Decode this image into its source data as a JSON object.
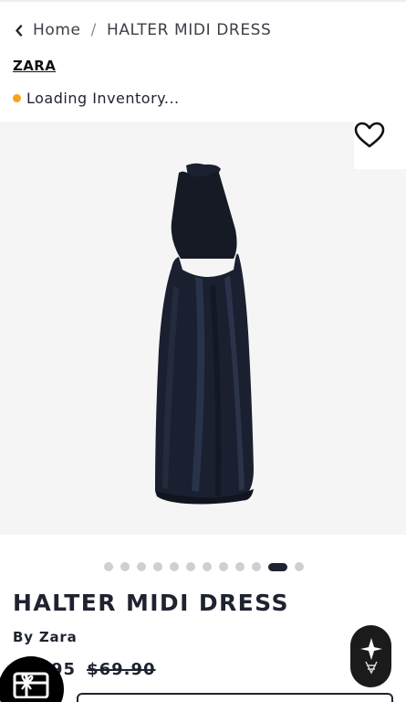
{
  "breadcrumb": {
    "home": "Home",
    "separator": "/",
    "current": "HALTER MIDI DRESS"
  },
  "brand_link": "ZARA",
  "inventory": {
    "status_text": "Loading Inventory...",
    "status_color": "#f4a416"
  },
  "gallery": {
    "image_count": 12,
    "active_index": 10,
    "image_alt": "Black satin halter midi dress"
  },
  "product": {
    "title": "HALTER MIDI DRESS",
    "byline": "By Zara",
    "sale_price_partial": "95",
    "original_price": "$69.90"
  },
  "icons": {
    "back": "chevron-left-icon",
    "wishlist": "heart-icon",
    "gift": "gift-card-icon",
    "assistant": "sparkle-logo-icon"
  },
  "colors": {
    "text": "#1f2330",
    "dot_inactive": "#cfcfd2",
    "dot_active": "#1f2330",
    "gallery_bg": "#f5f5f5"
  }
}
